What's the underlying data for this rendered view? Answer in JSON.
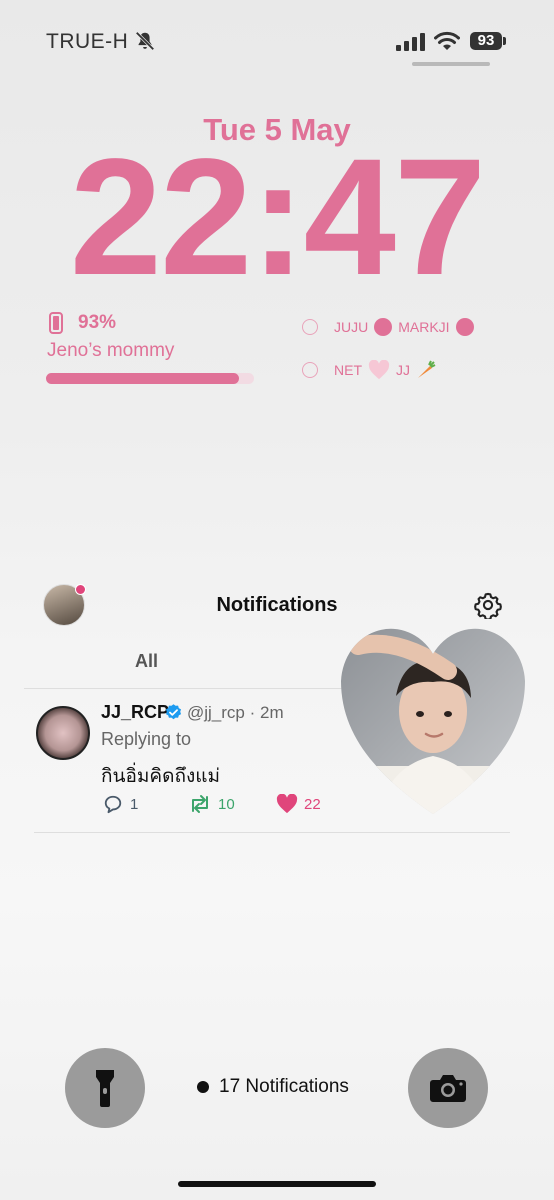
{
  "status_bar": {
    "carrier": "TRUE-H",
    "battery": "93"
  },
  "lock": {
    "date": "Tue 5 May",
    "time": "22:47"
  },
  "battery_widget": {
    "percent": "93%",
    "device_name": "Jeno’s mommy",
    "level": 0.93
  },
  "reminders": [
    {
      "text_a": "JUJU",
      "text_b": "MARKJI"
    },
    {
      "text_a": "NET",
      "text_b": "JJ"
    }
  ],
  "twitter": {
    "header_title": "Notifications",
    "tab": "All",
    "tweet": {
      "username": "JJ_RCP",
      "meta": "@jj_rcp · 2m",
      "replying": "Replying to",
      "text": "กินอิ่มคิดถึงแม่",
      "replies": "1",
      "retweets": "10",
      "likes": "22"
    }
  },
  "bottom": {
    "notifications": "17 Notifications"
  },
  "colors": {
    "accent_pink": "#e07197",
    "twitter_pink": "#e0457b",
    "retweet_green": "#3ca56b",
    "verified_blue": "#1d9bf0"
  }
}
